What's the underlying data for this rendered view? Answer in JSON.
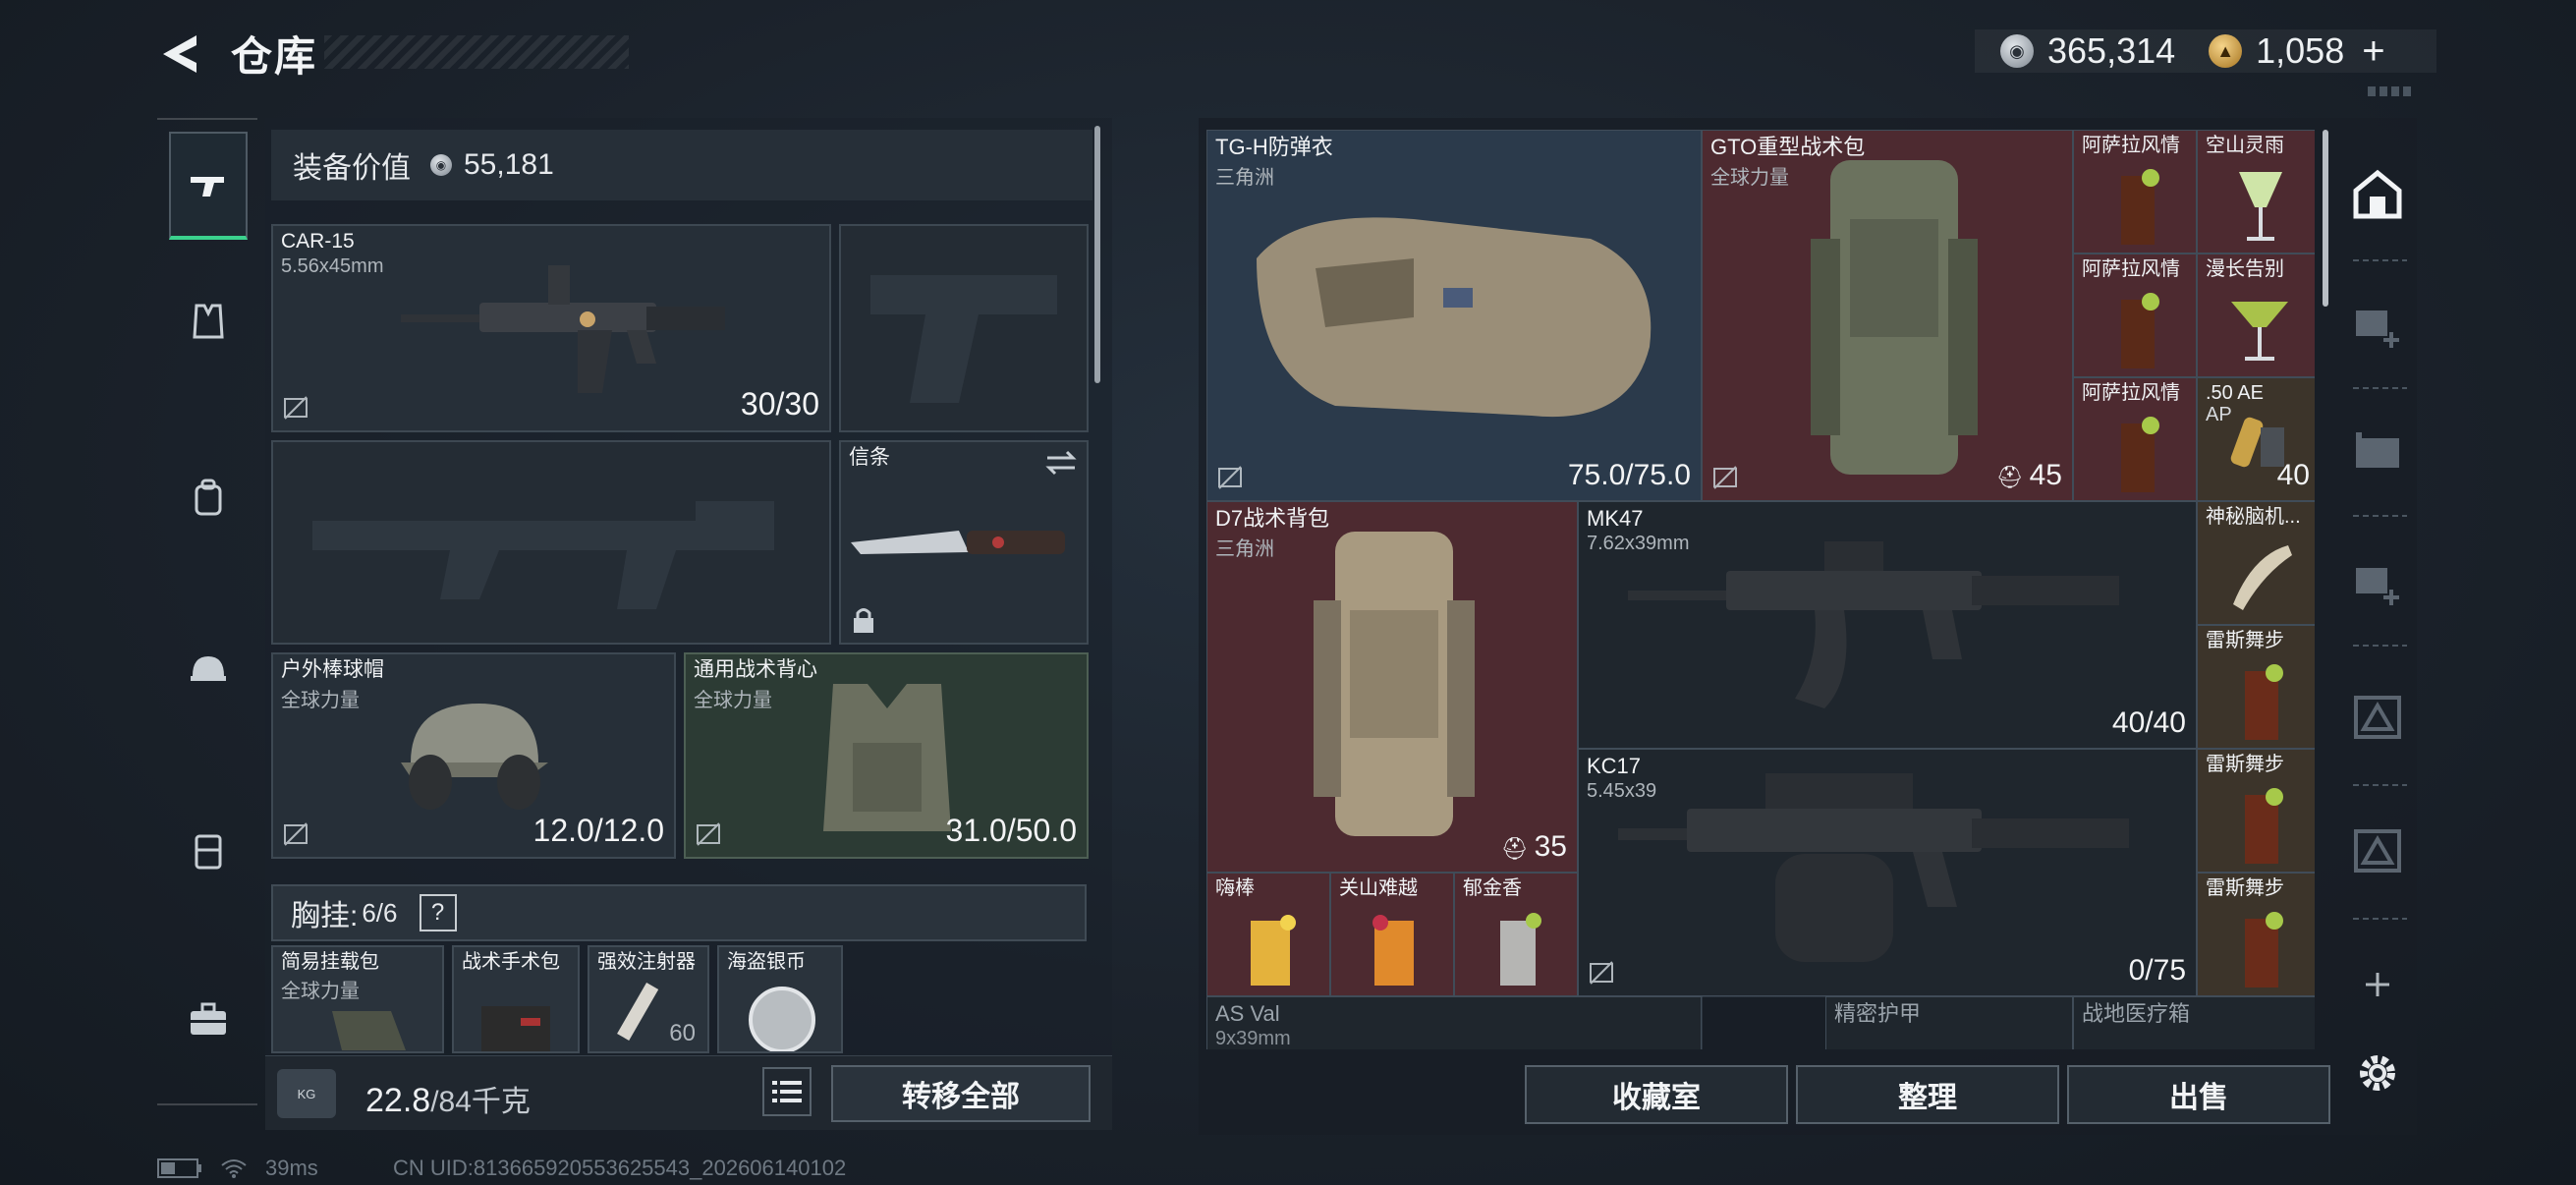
{
  "header": {
    "title": "仓库"
  },
  "currency": {
    "silver": "365,314",
    "gold": "1,058",
    "plus": "+"
  },
  "left_rail": {
    "tabs": [
      {
        "name": "weapons",
        "active": true
      },
      {
        "name": "armor"
      },
      {
        "name": "backpack"
      },
      {
        "name": "helmet"
      },
      {
        "name": "chest-rig"
      },
      {
        "name": "toolbox"
      }
    ]
  },
  "loadout": {
    "value_label": "装备价值",
    "value": "55,181",
    "primary": {
      "name": "CAR-15",
      "ammo": "5.56x45mm",
      "count": "30/30"
    },
    "secondary": {
      "name": "",
      "count": ""
    },
    "melee": {
      "name": "信条"
    },
    "helmet": {
      "name": "户外棒球帽",
      "faction": "全球力量",
      "durability": "12.0/12.0"
    },
    "vest": {
      "name": "通用战术背心",
      "faction": "全球力量",
      "durability": "31.0/50.0"
    },
    "chest": {
      "label": "胸挂:",
      "capacity": "6/6",
      "help": "?"
    },
    "chest_items": [
      {
        "name": "简易挂载包",
        "sub": "全球力量"
      },
      {
        "name": "战术手术包",
        "sub": ""
      },
      {
        "name": "强效注射器",
        "sub": "60"
      },
      {
        "name": "海盗银币",
        "sub": ""
      }
    ],
    "weight": {
      "current": "22.8",
      "max": "/84千克",
      "icon": "KG"
    },
    "transfer_all": "转移全部"
  },
  "storage": {
    "items": [
      {
        "name": "TG-H防弹衣",
        "sub": "三角洲",
        "value": "75.0/75.0"
      },
      {
        "name": "GTO重型战术包",
        "sub": "全球力量",
        "value": "45"
      },
      {
        "name": "阿萨拉风情",
        "sub": ""
      },
      {
        "name": "空山灵雨",
        "sub": ""
      },
      {
        "name": "阿萨拉风情",
        "sub": ""
      },
      {
        "name": "漫长告别",
        "sub": ""
      },
      {
        "name": "阿萨拉风情",
        "sub": ""
      },
      {
        "name": ".50 AE",
        "sub": "AP",
        "value": "40"
      },
      {
        "name": "D7战术背包",
        "sub": "三角洲",
        "value": "35"
      },
      {
        "name": "MK47",
        "sub": "7.62x39mm",
        "value": "40/40"
      },
      {
        "name": "神秘脑机...",
        "sub": ""
      },
      {
        "name": "雷斯舞步",
        "sub": ""
      },
      {
        "name": "KC17",
        "sub": "5.45x39",
        "value": "0/75"
      },
      {
        "name": "雷斯舞步",
        "sub": ""
      },
      {
        "name": "雷斯舞步",
        "sub": ""
      },
      {
        "name": "嗨棒",
        "sub": ""
      },
      {
        "name": "关山难越",
        "sub": ""
      },
      {
        "name": "郁金香",
        "sub": ""
      },
      {
        "name": "AS Val",
        "sub": "9x39mm"
      },
      {
        "name": "精密护甲",
        "sub": ""
      },
      {
        "name": "战地医疗箱",
        "sub": ""
      }
    ],
    "actions": {
      "collection": "收藏室",
      "sort": "整理",
      "sell": "出售"
    }
  },
  "status": {
    "ping": "39ms",
    "uid": "CN UID:813665920553625543_202606140102"
  },
  "colors": {
    "accent_green": "#3bd28e",
    "item_red": "#4d2a30",
    "item_blue": "#2b3a4b"
  }
}
